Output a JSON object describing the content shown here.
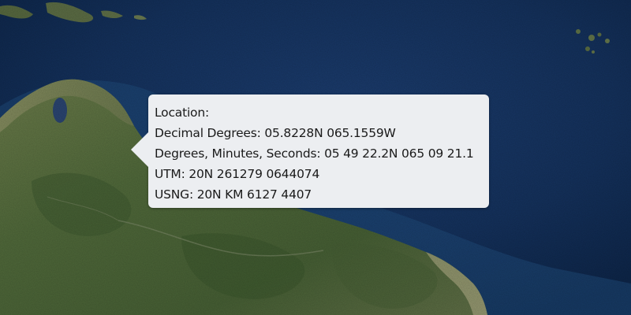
{
  "map": {
    "basemap": "imagery",
    "ocean_color": "#13305a",
    "land_color": "#4f6a3a"
  },
  "callout": {
    "title": "Location:",
    "decimal_degrees": "Decimal Degrees: 05.8228N 065.1559W",
    "dms": "Degrees, Minutes, Seconds: 05 49 22.2N 065 09 21.1",
    "utm": "UTM: 20N 261279 0644074",
    "usng": "USNG: 20N KM 6127 4407"
  }
}
